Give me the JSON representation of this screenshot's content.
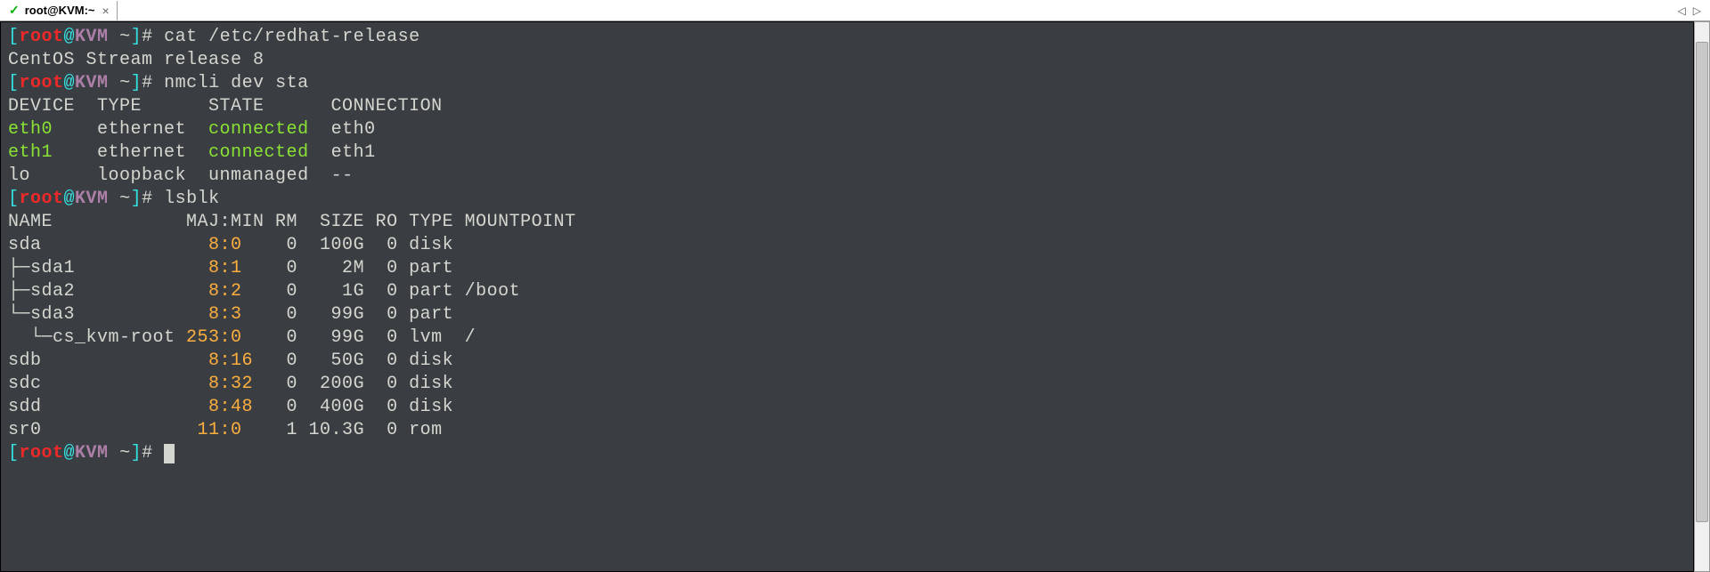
{
  "titlebar": {
    "tab_title": "root@KVM:~",
    "close_glyph": "×",
    "check_glyph": "✓",
    "nav_left": "◁",
    "nav_right": "▷"
  },
  "prompt": {
    "lbracket": "[",
    "user": "root",
    "at": "@",
    "host": "KVM",
    "path": " ~",
    "rbracket": "]",
    "symbol": "# "
  },
  "commands": {
    "cat": "cat /etc/redhat-release",
    "nmcli": "nmcli dev sta",
    "lsblk": "lsblk"
  },
  "output": {
    "release": "CentOS Stream release 8",
    "nmcli_header": "DEVICE  TYPE      STATE      CONNECTION ",
    "nmcli_rows": [
      {
        "dev": "eth0    ",
        "type": "ethernet  ",
        "state": "connected  ",
        "conn": "eth0       "
      },
      {
        "dev": "eth1    ",
        "type": "ethernet  ",
        "state": "connected  ",
        "conn": "eth1       "
      },
      {
        "dev": "lo      ",
        "type": "loopback  ",
        "state": "unmanaged  ",
        "conn": "--         "
      }
    ],
    "lsblk_header": "NAME            MAJ:MIN RM  SIZE RO TYPE MOUNTPOINT",
    "lsblk_rows": [
      {
        "name": "sda             ",
        "mm": "  8:0  ",
        "rest": "  0  100G  0 disk "
      },
      {
        "name": "├─sda1          ",
        "mm": "  8:1  ",
        "rest": "  0    2M  0 part "
      },
      {
        "name": "├─sda2          ",
        "mm": "  8:2  ",
        "rest": "  0    1G  0 part /boot"
      },
      {
        "name": "└─sda3          ",
        "mm": "  8:3  ",
        "rest": "  0   99G  0 part "
      },
      {
        "name": "  └─cs_kvm-root ",
        "mm": "253:0  ",
        "rest": "  0   99G  0 lvm  /"
      },
      {
        "name": "sdb             ",
        "mm": "  8:16 ",
        "rest": "  0   50G  0 disk "
      },
      {
        "name": "sdc             ",
        "mm": "  8:32 ",
        "rest": "  0  200G  0 disk "
      },
      {
        "name": "sdd             ",
        "mm": "  8:48 ",
        "rest": "  0  400G  0 disk "
      },
      {
        "name": "sr0             ",
        "mm": " 11:0  ",
        "rest": "  1 10.3G  0 rom  "
      }
    ]
  }
}
